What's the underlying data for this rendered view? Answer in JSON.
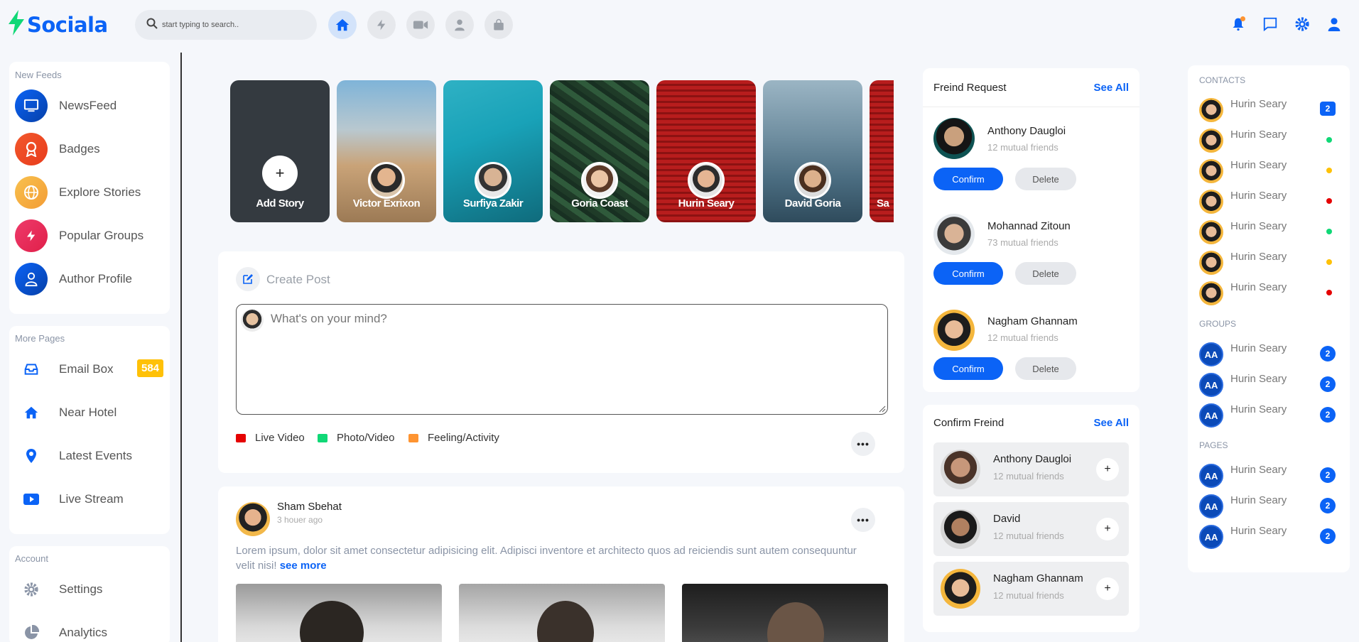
{
  "app": {
    "brand": "Sociala",
    "search_placeholder": "start typing to search..",
    "brand_color": "#0b63f6"
  },
  "header": {
    "nav_icons": [
      "home-icon",
      "bolt-icon",
      "video-icon",
      "user-icon",
      "shopping-bag-icon"
    ],
    "right_icons": [
      "bell-icon",
      "chat-icon",
      "gear-icon",
      "user-icon"
    ]
  },
  "sidebar": {
    "new_feeds_title": "New Feeds",
    "feeds": [
      {
        "label": "NewsFeed",
        "icon": "tv-icon"
      },
      {
        "label": "Badges",
        "icon": "award-icon"
      },
      {
        "label": "Explore Stories",
        "icon": "globe-icon"
      },
      {
        "label": "Popular Groups",
        "icon": "bolt-icon"
      },
      {
        "label": "Author Profile",
        "icon": "user-icon"
      }
    ],
    "more_pages_title": "More Pages",
    "pages": [
      {
        "label": "Email Box",
        "icon": "inbox-icon",
        "badge": "584"
      },
      {
        "label": "Near Hotel",
        "icon": "home-icon"
      },
      {
        "label": "Latest Events",
        "icon": "map-pin-icon"
      },
      {
        "label": "Live Stream",
        "icon": "youtube-icon"
      }
    ],
    "account_title": "Account",
    "account": [
      {
        "label": "Settings",
        "icon": "gear-icon"
      },
      {
        "label": "Analytics",
        "icon": "pie-chart-icon"
      }
    ]
  },
  "stories": [
    {
      "name": "Add Story",
      "add": true
    },
    {
      "name": "Victor Exrixon"
    },
    {
      "name": "Surfiya Zakir"
    },
    {
      "name": "Goria Coast"
    },
    {
      "name": "Hurin Seary"
    },
    {
      "name": "David Goria"
    },
    {
      "name": "Sa"
    }
  ],
  "create_post": {
    "title": "Create Post",
    "placeholder": "What's on your mind?",
    "actions": [
      {
        "label": "Live Video",
        "color": "#e50202"
      },
      {
        "label": "Photo/Video",
        "color": "#10d876"
      },
      {
        "label": "Feeling/Activity",
        "color": "#fe9431"
      }
    ]
  },
  "post": {
    "author": "Sham Sbehat",
    "time": "3 houer ago",
    "text": "Lorem ipsum, dolor sit amet consectetur adipisicing elit. Adipisci inventore et architecto quos ad reiciendis sunt autem consequuntur velit nisi!",
    "see_more": "see more"
  },
  "friend_requests": {
    "title": "Freind Request",
    "see_all": "See All",
    "items": [
      {
        "name": "Anthony Daugloi",
        "mutual": "12 mutual friends"
      },
      {
        "name": "Mohannad Zitoun",
        "mutual": "73 mutual friends"
      },
      {
        "name": "Nagham Ghannam",
        "mutual": "12 mutual friends"
      }
    ],
    "confirm_label": "Confirm",
    "delete_label": "Delete"
  },
  "confirm_friend": {
    "title": "Confirm Freind",
    "see_all": "See All",
    "items": [
      {
        "name": "Anthony Daugloi",
        "mutual": "12 mutual friends"
      },
      {
        "name": "David",
        "mutual": "12 mutual friends"
      },
      {
        "name": "Nagham Ghannam",
        "mutual": "12 mutual friends"
      }
    ],
    "plus": "+"
  },
  "contacts": {
    "contacts_title": "CONTACTS",
    "contacts": [
      {
        "name": "Hurin Seary",
        "count": "2"
      },
      {
        "name": "Hurin Seary",
        "status": "#10d876"
      },
      {
        "name": "Hurin Seary",
        "status": "#fec107"
      },
      {
        "name": "Hurin Seary",
        "status": "#e50202"
      },
      {
        "name": "Hurin Seary",
        "status": "#10d876"
      },
      {
        "name": "Hurin Seary",
        "status": "#fec107"
      },
      {
        "name": "Hurin Seary",
        "status": "#e50202"
      }
    ],
    "groups_title": "GROUPS",
    "groups": [
      {
        "initials": "AA",
        "name": "Hurin Seary",
        "count": "2"
      },
      {
        "initials": "AA",
        "name": "Hurin Seary",
        "count": "2"
      },
      {
        "initials": "AA",
        "name": "Hurin Seary",
        "count": "2"
      }
    ],
    "pages_title": "PAGES",
    "pages": [
      {
        "initials": "AA",
        "name": "Hurin Seary",
        "count": "2"
      },
      {
        "initials": "AA",
        "name": "Hurin Seary",
        "count": "2"
      },
      {
        "initials": "AA",
        "name": "Hurin Seary",
        "count": "2"
      }
    ]
  }
}
